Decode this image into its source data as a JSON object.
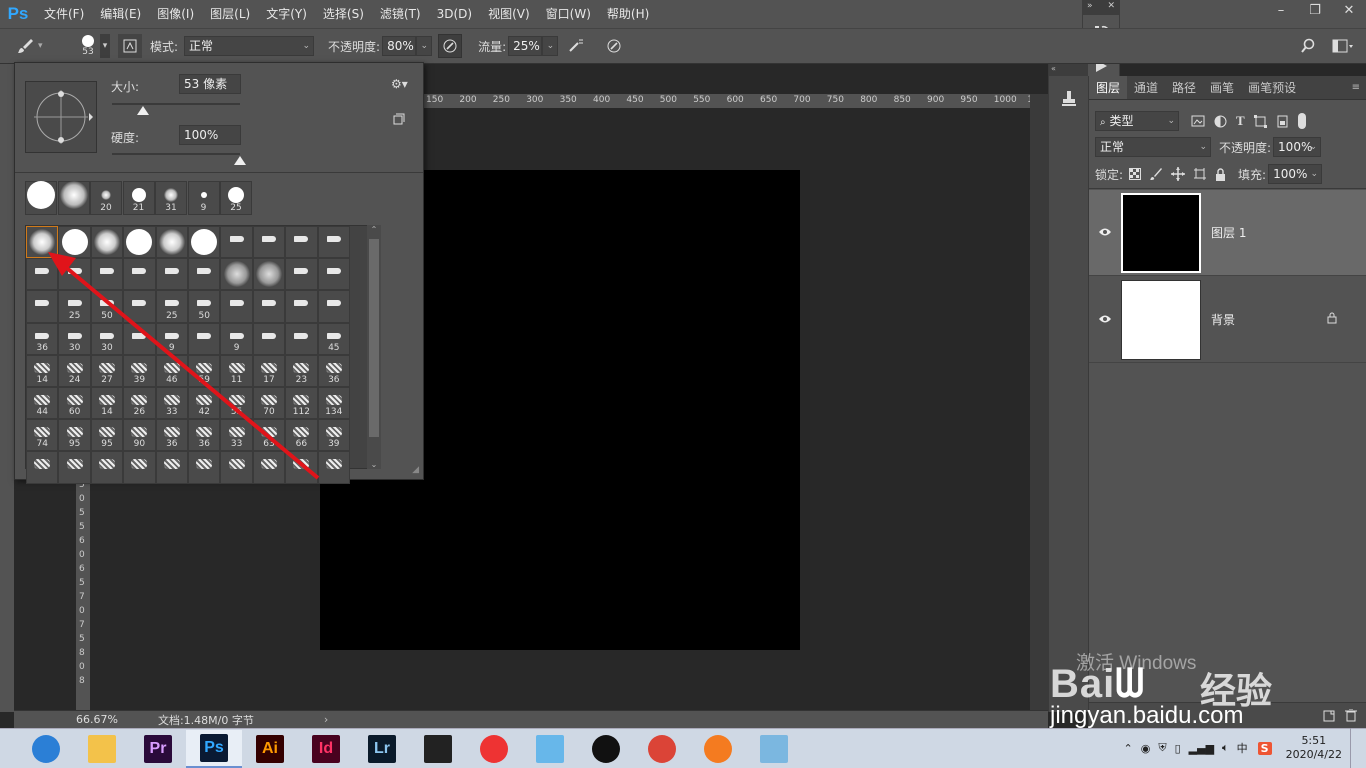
{
  "app": {
    "logo": "Ps"
  },
  "menu": [
    "文件(F)",
    "编辑(E)",
    "图像(I)",
    "图层(L)",
    "文字(Y)",
    "选择(S)",
    "滤镜(T)",
    "3D(D)",
    "视图(V)",
    "窗口(W)",
    "帮助(H)"
  ],
  "options": {
    "brush_size": "53",
    "mode_label": "模式:",
    "mode_value": "正常",
    "opacity_label": "不透明度:",
    "opacity_value": "80%",
    "flow_label": "流量:",
    "flow_value": "25%"
  },
  "picker": {
    "size_label": "大小:",
    "size_value": "53 像素",
    "size_fraction": 0.13,
    "hardness_label": "硬度:",
    "hardness_value": "100%",
    "hardness_fraction": 1.0,
    "recent_labels": [
      "",
      "",
      "20",
      "21",
      "31",
      "9",
      "25"
    ],
    "grid_labels": [
      [
        "",
        "",
        "",
        "",
        "",
        "",
        "",
        "",
        "",
        ""
      ],
      [
        "",
        "",
        "",
        "",
        "",
        "",
        "",
        "",
        "",
        ""
      ],
      [
        "",
        "25",
        "50",
        "",
        "25",
        "50",
        "",
        "",
        "",
        ""
      ],
      [
        "36",
        "30",
        "30",
        "",
        "9",
        "",
        "9",
        "",
        "",
        "45"
      ],
      [
        "14",
        "24",
        "27",
        "39",
        "46",
        "59",
        "11",
        "17",
        "23",
        "36"
      ],
      [
        "44",
        "60",
        "14",
        "26",
        "33",
        "42",
        "55",
        "70",
        "112",
        "134"
      ],
      [
        "74",
        "95",
        "95",
        "90",
        "36",
        "36",
        "33",
        "63",
        "66",
        "39"
      ],
      [
        "",
        "",
        "",
        "",
        "",
        "",
        "",
        "",
        "",
        ""
      ]
    ]
  },
  "ruler_top_labels": [
    "150",
    "200",
    "250",
    "300",
    "350",
    "400",
    "450",
    "500",
    "550",
    "600",
    "650",
    "700",
    "750",
    "800",
    "850",
    "900",
    "950",
    "1000",
    "10"
  ],
  "ruler_left_labels": [
    "5",
    "0",
    "5",
    "5",
    "6",
    "0",
    "6",
    "5",
    "7",
    "0",
    "7",
    "5",
    "8",
    "0",
    "8"
  ],
  "status": {
    "zoom": "66.67%",
    "doc": "文档:1.48M/0 字节"
  },
  "layers_panel": {
    "tabs": [
      "图层",
      "通道",
      "路径",
      "画笔",
      "画笔预设"
    ],
    "filter_value": "类型",
    "blend_value": "正常",
    "opacity_label": "不透明度:",
    "opacity_value": "100%",
    "lock_label": "锁定:",
    "fill_label": "填充:",
    "fill_value": "100%",
    "layers": [
      {
        "name": "图层 1",
        "thumb": "#000000",
        "selected": true,
        "locked": false
      },
      {
        "name": "背景",
        "thumb": "#ffffff",
        "selected": false,
        "locked": true
      }
    ]
  },
  "watermark": {
    "line1": "激活 Windows",
    "line2": "经验",
    "line3": "jingyan.baidu.com"
  },
  "taskbar": {
    "apps": [
      {
        "name": "browser",
        "label": "",
        "bg": "#2b7fd6",
        "fg": "#fff"
      },
      {
        "name": "explorer",
        "label": "",
        "bg": "#f3c24a",
        "fg": "#fff"
      },
      {
        "name": "premiere",
        "label": "Pr",
        "bg": "#2a0a3a",
        "fg": "#d99dff"
      },
      {
        "name": "photoshop",
        "label": "Ps",
        "bg": "#0a1a33",
        "fg": "#31a8ff"
      },
      {
        "name": "illustrator",
        "label": "Ai",
        "bg": "#330000",
        "fg": "#ff9a00"
      },
      {
        "name": "indesign",
        "label": "Id",
        "bg": "#49021f",
        "fg": "#ff3366"
      },
      {
        "name": "lightroom",
        "label": "Lr",
        "bg": "#0a1a2a",
        "fg": "#8cc6f0"
      },
      {
        "name": "video-editor",
        "label": "",
        "bg": "#222",
        "fg": "#fff"
      },
      {
        "name": "umbrella-app",
        "label": "",
        "bg": "#e33",
        "fg": "#fff"
      },
      {
        "name": "chat-app",
        "label": "",
        "bg": "#67b7ea",
        "fg": "#fff"
      },
      {
        "name": "qq",
        "label": "",
        "bg": "#111",
        "fg": "#fff"
      },
      {
        "name": "chrome",
        "label": "",
        "bg": "#db4437",
        "fg": "#fff"
      },
      {
        "name": "orange-app",
        "label": "",
        "bg": "#f47b20",
        "fg": "#fff"
      },
      {
        "name": "notes-app",
        "label": "",
        "bg": "#7bb7e0",
        "fg": "#fff"
      }
    ]
  },
  "tray": {
    "ime": "中",
    "sogou": "S",
    "time": "5:51",
    "date": "2020/4/22"
  },
  "colors": {
    "arrow": "#e0141a",
    "accent": "#31a8ff"
  }
}
